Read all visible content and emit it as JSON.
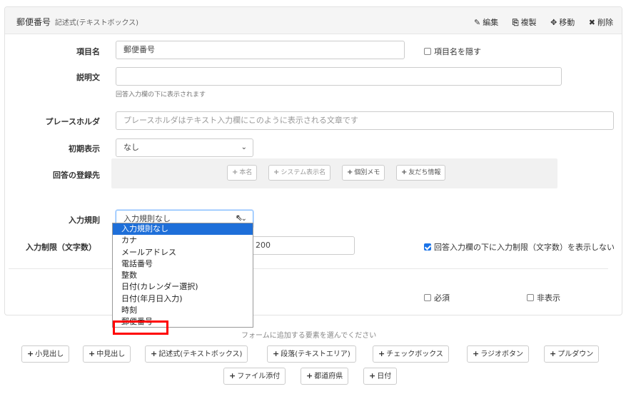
{
  "header": {
    "title": "郵便番号",
    "subtitle": "記述式(テキストボックス)",
    "actions": [
      {
        "icon": "pencil-icon",
        "glyph": "✎",
        "label": "編集"
      },
      {
        "icon": "copy-icon",
        "glyph": "⎘",
        "label": "複製"
      },
      {
        "icon": "move-icon",
        "glyph": "✥",
        "label": "移動"
      },
      {
        "icon": "delete-icon",
        "glyph": "✖",
        "label": "削除"
      }
    ]
  },
  "fields": {
    "item_name": {
      "label": "項目名",
      "value": "郵便番号",
      "hide_label": "項目名を隠す"
    },
    "description": {
      "label": "説明文",
      "value": "",
      "help": "回答入力欄の下に表示されます"
    },
    "placeholder": {
      "label": "プレースホルダ",
      "placeholder": "プレースホルダはテキスト入力欄にこのように表示される文章です"
    },
    "initial_display": {
      "label": "初期表示",
      "value": "なし"
    },
    "destination": {
      "label": "回答の登録先",
      "chips": [
        {
          "label": "本名",
          "enabled": false
        },
        {
          "label": "システム表示名",
          "enabled": false
        },
        {
          "label": "個別メモ",
          "enabled": true
        },
        {
          "label": "友だち情報",
          "enabled": true
        }
      ]
    },
    "input_rule": {
      "label": "入力規則",
      "value": "入力規則なし"
    },
    "char_limit": {
      "label": "入力制限（文字数）",
      "value": "200",
      "hide_label": "回答入力欄の下に入力制限（文字数）を表示しない"
    },
    "required_label": "必須",
    "hidden_label": "非表示"
  },
  "dropdown": {
    "options": [
      "入力規則なし",
      "カナ",
      "メールアドレス",
      "電話番号",
      "整数",
      "日付(カレンダー選択)",
      "日付(年月日入力)",
      "時刻",
      "郵便番号"
    ],
    "selected_index": 0
  },
  "add_hint": "フォームに追加する要素を選んでください",
  "add_buttons_row1": [
    "小見出し",
    "中見出し",
    "記述式(テキストボックス)",
    "段落(テキストエリア)",
    "チェックボックス",
    "ラジオボタン",
    "プルダウン"
  ],
  "add_buttons_row2": [
    "ファイル添付",
    "都道府県",
    "日付"
  ]
}
